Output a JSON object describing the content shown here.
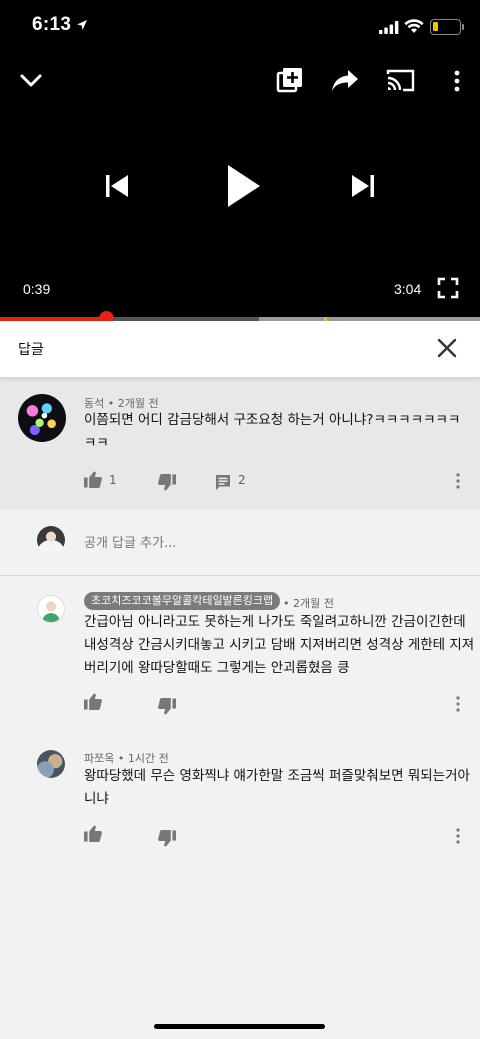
{
  "status_bar": {
    "time": "6:13"
  },
  "player": {
    "current_time": "0:39",
    "duration": "3:04",
    "progress": {
      "played_fraction": 0.22,
      "buffered_from": 0.54,
      "buffered_to": 1.0,
      "marker_fraction": 0.675
    }
  },
  "replies_panel": {
    "title": "답글"
  },
  "parent_comment": {
    "author": "동석",
    "time": "2개월 전",
    "text": "이쯤되면 어디 감금당해서 구조요청 하는거 아니냐?ㅋㅋㅋㅋㅋㅋㅋㅋㅋ",
    "likes": "1",
    "replies": "2"
  },
  "add_reply": {
    "placeholder": "공개 답글 추가..."
  },
  "replies": [
    {
      "author": "초코치즈코코볼무알콜칵테일발른킹크랩",
      "time": "2개월 전",
      "line1": "간급아님 아니라고도 못하는게 나가도 죽일려고하니깐 간금이긴한데",
      "line2": "내성격상 간금시키대놓고 시키고 담배 지져버리면 성격상 게한테 지져",
      "line3": "버리기에 왕따당할때도 그렇게는 안괴롭혔음 킁"
    },
    {
      "author": "파쪼옥",
      "time": "1시간 전",
      "line1": "왕따당했데 무슨 영화찍냐 얘가한말 조금씩 퍼즐맞춰보면 뭐되는거아",
      "line2": "니냐"
    }
  ],
  "icons": {
    "collapse": "chevron-down-icon",
    "add_to_playlist": "playlist-add-icon",
    "share": "share-icon",
    "cast": "cast-icon",
    "more": "more-vert-icon",
    "previous": "skip-previous-icon",
    "play": "play-icon",
    "next": "skip-next-icon",
    "fullscreen": "fullscreen-icon",
    "close": "close-icon",
    "like": "thumb-up-icon",
    "dislike": "thumb-down-icon",
    "comment": "comment-icon"
  },
  "colors": {
    "accent": "#e62117",
    "player_bg": "#000000",
    "page_bg": "#f2f2f2",
    "highlight_bg": "#e8e8e8"
  }
}
